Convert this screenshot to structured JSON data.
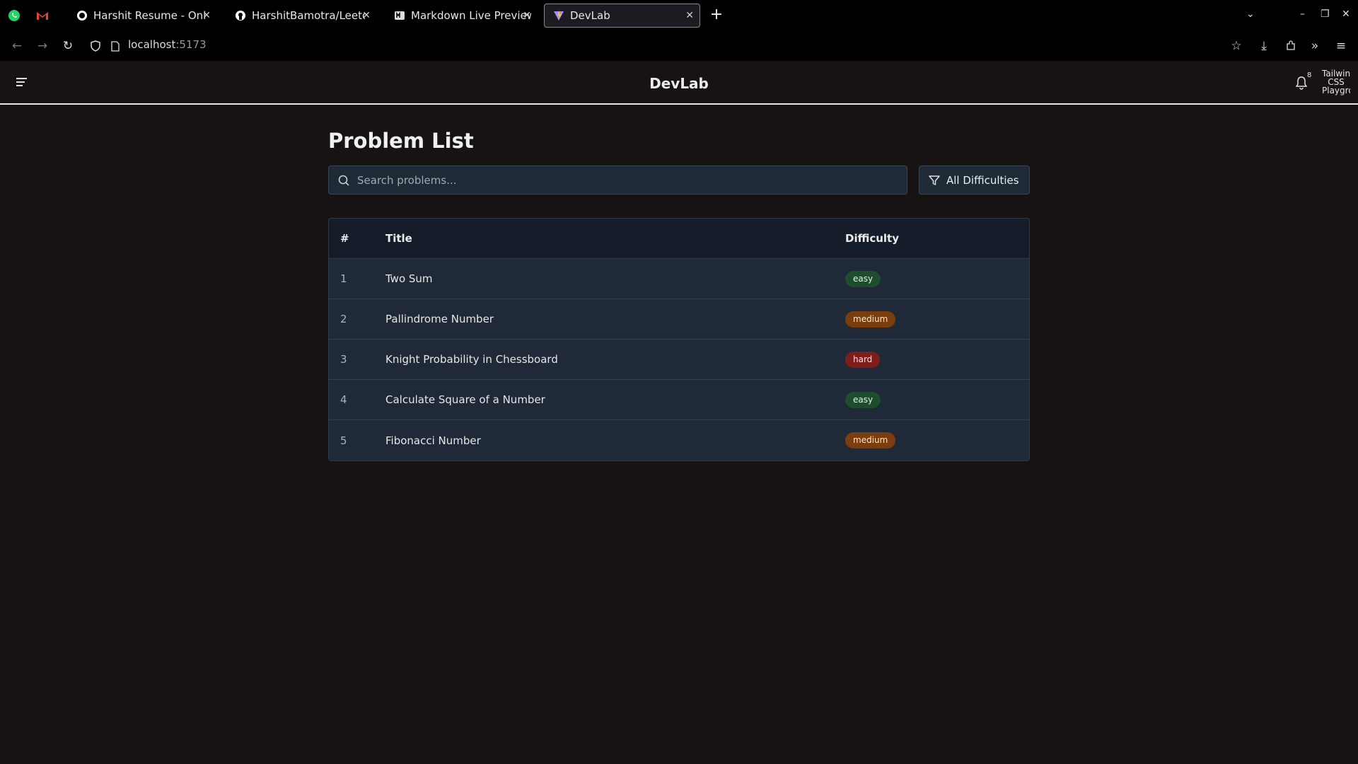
{
  "browser": {
    "tabs": [
      {
        "title": "Harshit Resume - Online",
        "icon": "google-docs-icon"
      },
      {
        "title": "HarshitBamotra/Leetcode",
        "icon": "github-icon"
      },
      {
        "title": "Markdown Live Preview",
        "icon": "markdown-icon"
      },
      {
        "title": "DevLab",
        "icon": "vite-icon",
        "active": true
      }
    ],
    "url_host": "localhost",
    "url_port": ":5173"
  },
  "header": {
    "brand": "DevLab",
    "notification_count": "8",
    "avatar_text": "Tailwind CSS Playground"
  },
  "page": {
    "title": "Problem List",
    "search_placeholder": "Search problems...",
    "filter_label": "All Difficulties"
  },
  "table": {
    "columns": [
      "#",
      "Title",
      "Difficulty"
    ],
    "rows": [
      {
        "num": "1",
        "title": "Two Sum",
        "difficulty": "easy"
      },
      {
        "num": "2",
        "title": "Pallindrome Number",
        "difficulty": "medium"
      },
      {
        "num": "3",
        "title": "Knight Probability in Chessboard",
        "difficulty": "hard"
      },
      {
        "num": "4",
        "title": "Calculate Square of a Number",
        "difficulty": "easy"
      },
      {
        "num": "5",
        "title": "Fibonacci Number",
        "difficulty": "medium"
      }
    ]
  },
  "colors": {
    "easy": "#1d4d2c",
    "medium": "#7a3e0c",
    "hard": "#7f1d1d",
    "surface": "#1f2937",
    "background": "#171312"
  }
}
